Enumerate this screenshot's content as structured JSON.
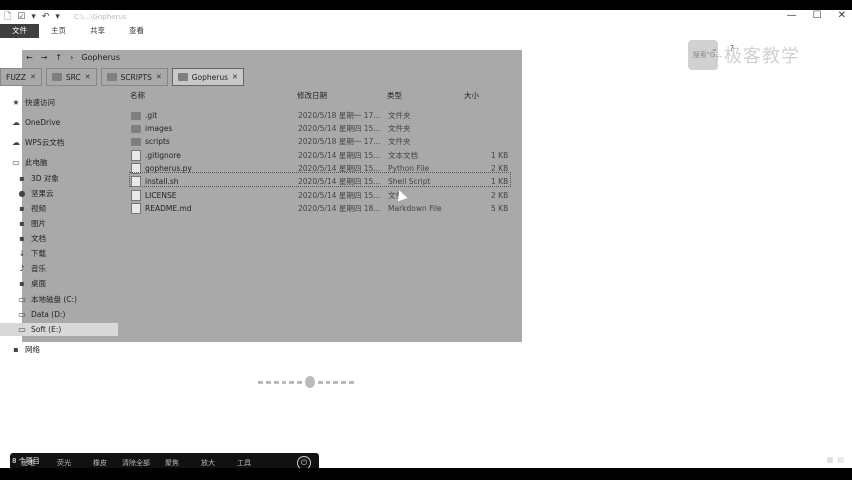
{
  "titlebar": {
    "title": "C:\\...\\Gopherus",
    "quick_access": [
      "🗋",
      "☑",
      "▾",
      "↶",
      "▾"
    ],
    "controls": [
      "—",
      "☐",
      "✕"
    ]
  },
  "ribbon": {
    "tabs": [
      "文件",
      "主页",
      "共享",
      "查看"
    ],
    "active_tab": "文件",
    "search_hint": "搜索\"G...",
    "right_icons": [
      "⌄",
      "?"
    ]
  },
  "address": {
    "back": "←",
    "forward": "→",
    "up": "↑",
    "path_sep": "›",
    "current": "Gopherus"
  },
  "tabs": [
    {
      "label": "FUZZ",
      "close": "✕"
    },
    {
      "label": "SRC",
      "close": "✕"
    },
    {
      "label": "SCRIPTS",
      "close": "✕"
    },
    {
      "label": "Gopherus",
      "close": "✕"
    }
  ],
  "sidebar": {
    "items": [
      {
        "label": "快速访问",
        "icon": "★"
      },
      {
        "label": "OneDrive",
        "icon": "☁"
      },
      {
        "label": "WPS云文档",
        "icon": "☁"
      },
      {
        "label": "此电脑",
        "icon": "▭"
      },
      {
        "label": "3D 对象",
        "icon": "▪"
      },
      {
        "label": "坚果云",
        "icon": "●"
      },
      {
        "label": "视频",
        "icon": "▪"
      },
      {
        "label": "图片",
        "icon": "▪"
      },
      {
        "label": "文档",
        "icon": "▪"
      },
      {
        "label": "下载",
        "icon": "↓"
      },
      {
        "label": "音乐",
        "icon": "♪"
      },
      {
        "label": "桌面",
        "icon": "▪"
      },
      {
        "label": "本地磁盘 (C:)",
        "icon": "▭"
      },
      {
        "label": "Data (D:)",
        "icon": "▭"
      },
      {
        "label": "Soft (E:)",
        "icon": "▭"
      },
      {
        "label": "网络",
        "icon": "▪"
      }
    ]
  },
  "columns": {
    "name": "名称",
    "date": "修改日期",
    "type": "类型",
    "size": "大小"
  },
  "files": [
    {
      "name": ".git",
      "date": "2020/5/18 星期一 17...",
      "type": "文件夹",
      "size": "",
      "kind": "folder"
    },
    {
      "name": "images",
      "date": "2020/5/14 星期四 15...",
      "type": "文件夹",
      "size": "",
      "kind": "folder"
    },
    {
      "name": "scripts",
      "date": "2020/5/18 星期一 17...",
      "type": "文件夹",
      "size": "",
      "kind": "folder"
    },
    {
      "name": ".gitignore",
      "date": "2020/5/14 星期四 15...",
      "type": "文本文档",
      "size": "1 KB",
      "kind": "file"
    },
    {
      "name": "gopherus.py",
      "date": "2020/5/14 星期四 15...",
      "type": "Python File",
      "size": "2 KB",
      "kind": "file"
    },
    {
      "name": "install.sh",
      "date": "2020/5/14 星期四 15...",
      "type": "Shell Script",
      "size": "1 KB",
      "kind": "file"
    },
    {
      "name": "LICENSE",
      "date": "2020/5/14 星期四 15...",
      "type": "文件",
      "size": "2 KB",
      "kind": "file"
    },
    {
      "name": "README.md",
      "date": "2020/5/14 星期四 18...",
      "type": "Markdown File",
      "size": "5 KB",
      "kind": "file"
    }
  ],
  "watermark": {
    "text": "极客教学"
  },
  "taskbar": {
    "items": [
      "画笔",
      "荧光",
      "橡皮",
      "清除全部",
      "聚焦",
      "放大",
      "工具"
    ],
    "power": "⏻"
  },
  "status": {
    "left": "8 个项目",
    "right": [
      "▦",
      "▤"
    ]
  }
}
